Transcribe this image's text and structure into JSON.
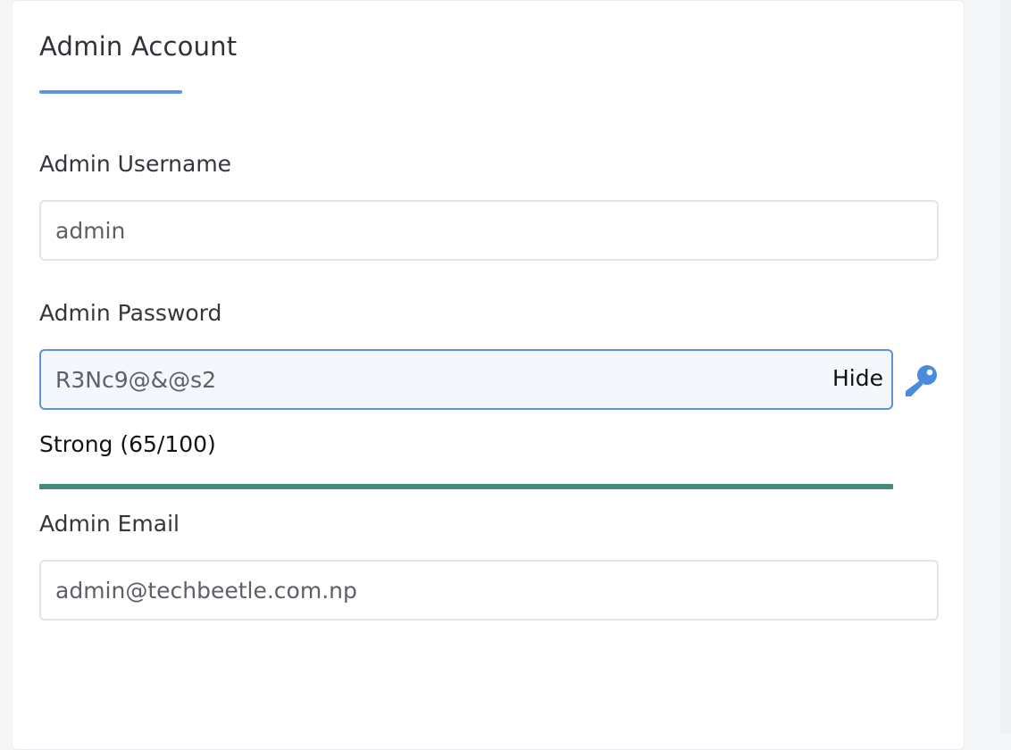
{
  "section": {
    "title": "Admin Account",
    "accent_color": "#5b93e0"
  },
  "username": {
    "label": "Admin Username",
    "value": "admin"
  },
  "password": {
    "label": "Admin Password",
    "value": "R3Nc9@&@s2",
    "toggle_label": "Hide",
    "generate_icon": "key-icon",
    "icon_color": "#4a8be0"
  },
  "strength": {
    "text": "Strong (65/100)",
    "bar_fill_fraction": 1.0,
    "bar_color": "#458a7e"
  },
  "email": {
    "label": "Admin Email",
    "value": "admin@techbeetle.com.np"
  }
}
